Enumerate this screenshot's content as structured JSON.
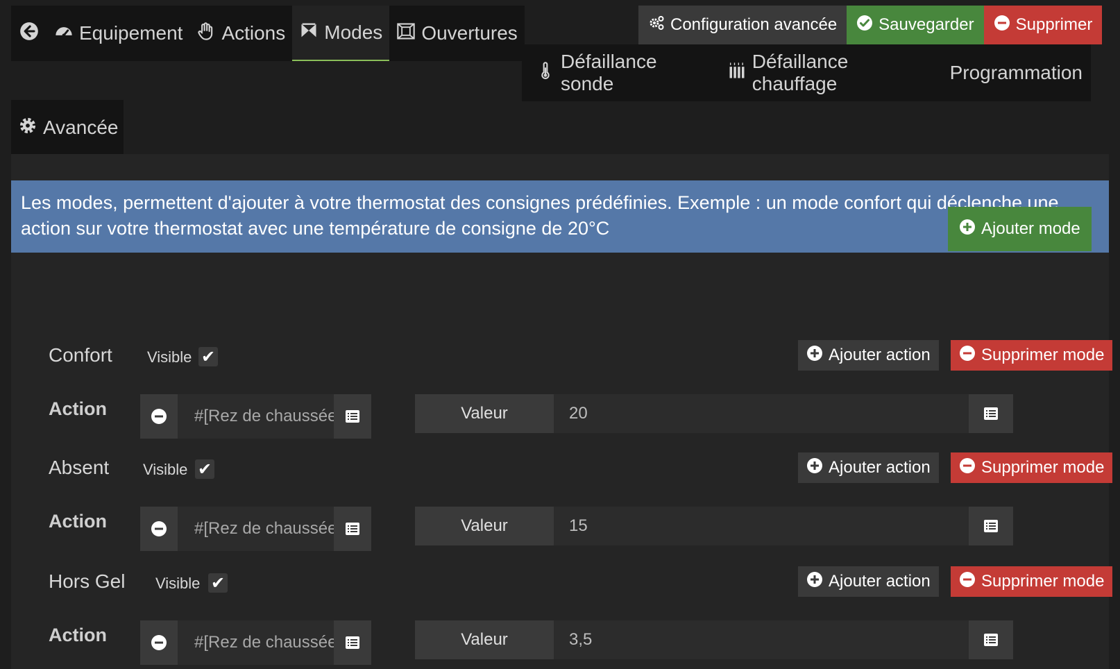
{
  "tabs": {
    "back_icon": "arrow-left-circle-icon",
    "equipement": "Equipement",
    "actions": "Actions",
    "modes": "Modes",
    "ouvertures": "Ouvertures",
    "defaillance_sonde": "Défaillance sonde",
    "defaillance_chauffage": "Défaillance chauffage",
    "programmation": "Programmation",
    "avancee": "Avancée",
    "active": "Modes"
  },
  "toolbar": {
    "config_label": "Configuration avancée",
    "save_label": "Sauvegarder",
    "delete_label": "Supprimer"
  },
  "info": {
    "text": "Les modes, permettent d'ajouter à votre thermostat des consignes prédéfinies. Exemple : un mode confort qui déclenche une action sur votre thermostat avec une température de consigne de 20°C",
    "add_mode_label": "Ajouter mode"
  },
  "modes": [
    {
      "name": "Confort",
      "visible_label": "Visible",
      "visible": true,
      "add_action_label": "Ajouter action",
      "delete_mode_label": "Supprimer mode",
      "action_label": "Action",
      "command": "#[Rez de chaussée",
      "value_label": "Valeur",
      "value": "20"
    },
    {
      "name": "Absent",
      "visible_label": "Visible",
      "visible": true,
      "add_action_label": "Ajouter action",
      "delete_mode_label": "Supprimer mode",
      "action_label": "Action",
      "command": "#[Rez de chaussée",
      "value_label": "Valeur",
      "value": "15"
    },
    {
      "name": "Hors Gel",
      "visible_label": "Visible",
      "visible": true,
      "add_action_label": "Ajouter action",
      "delete_mode_label": "Supprimer mode",
      "action_label": "Action",
      "command": "#[Rez de chaussée",
      "value_label": "Valeur",
      "value": "3,5"
    }
  ],
  "colors": {
    "background": "#1e1e1e",
    "tab_bar": "#141414",
    "info": "#5578a8",
    "success": "#48873d",
    "danger": "#c43b36",
    "neutral": "#3a3a3a",
    "active_tab_underline": "#8bbf5a"
  }
}
